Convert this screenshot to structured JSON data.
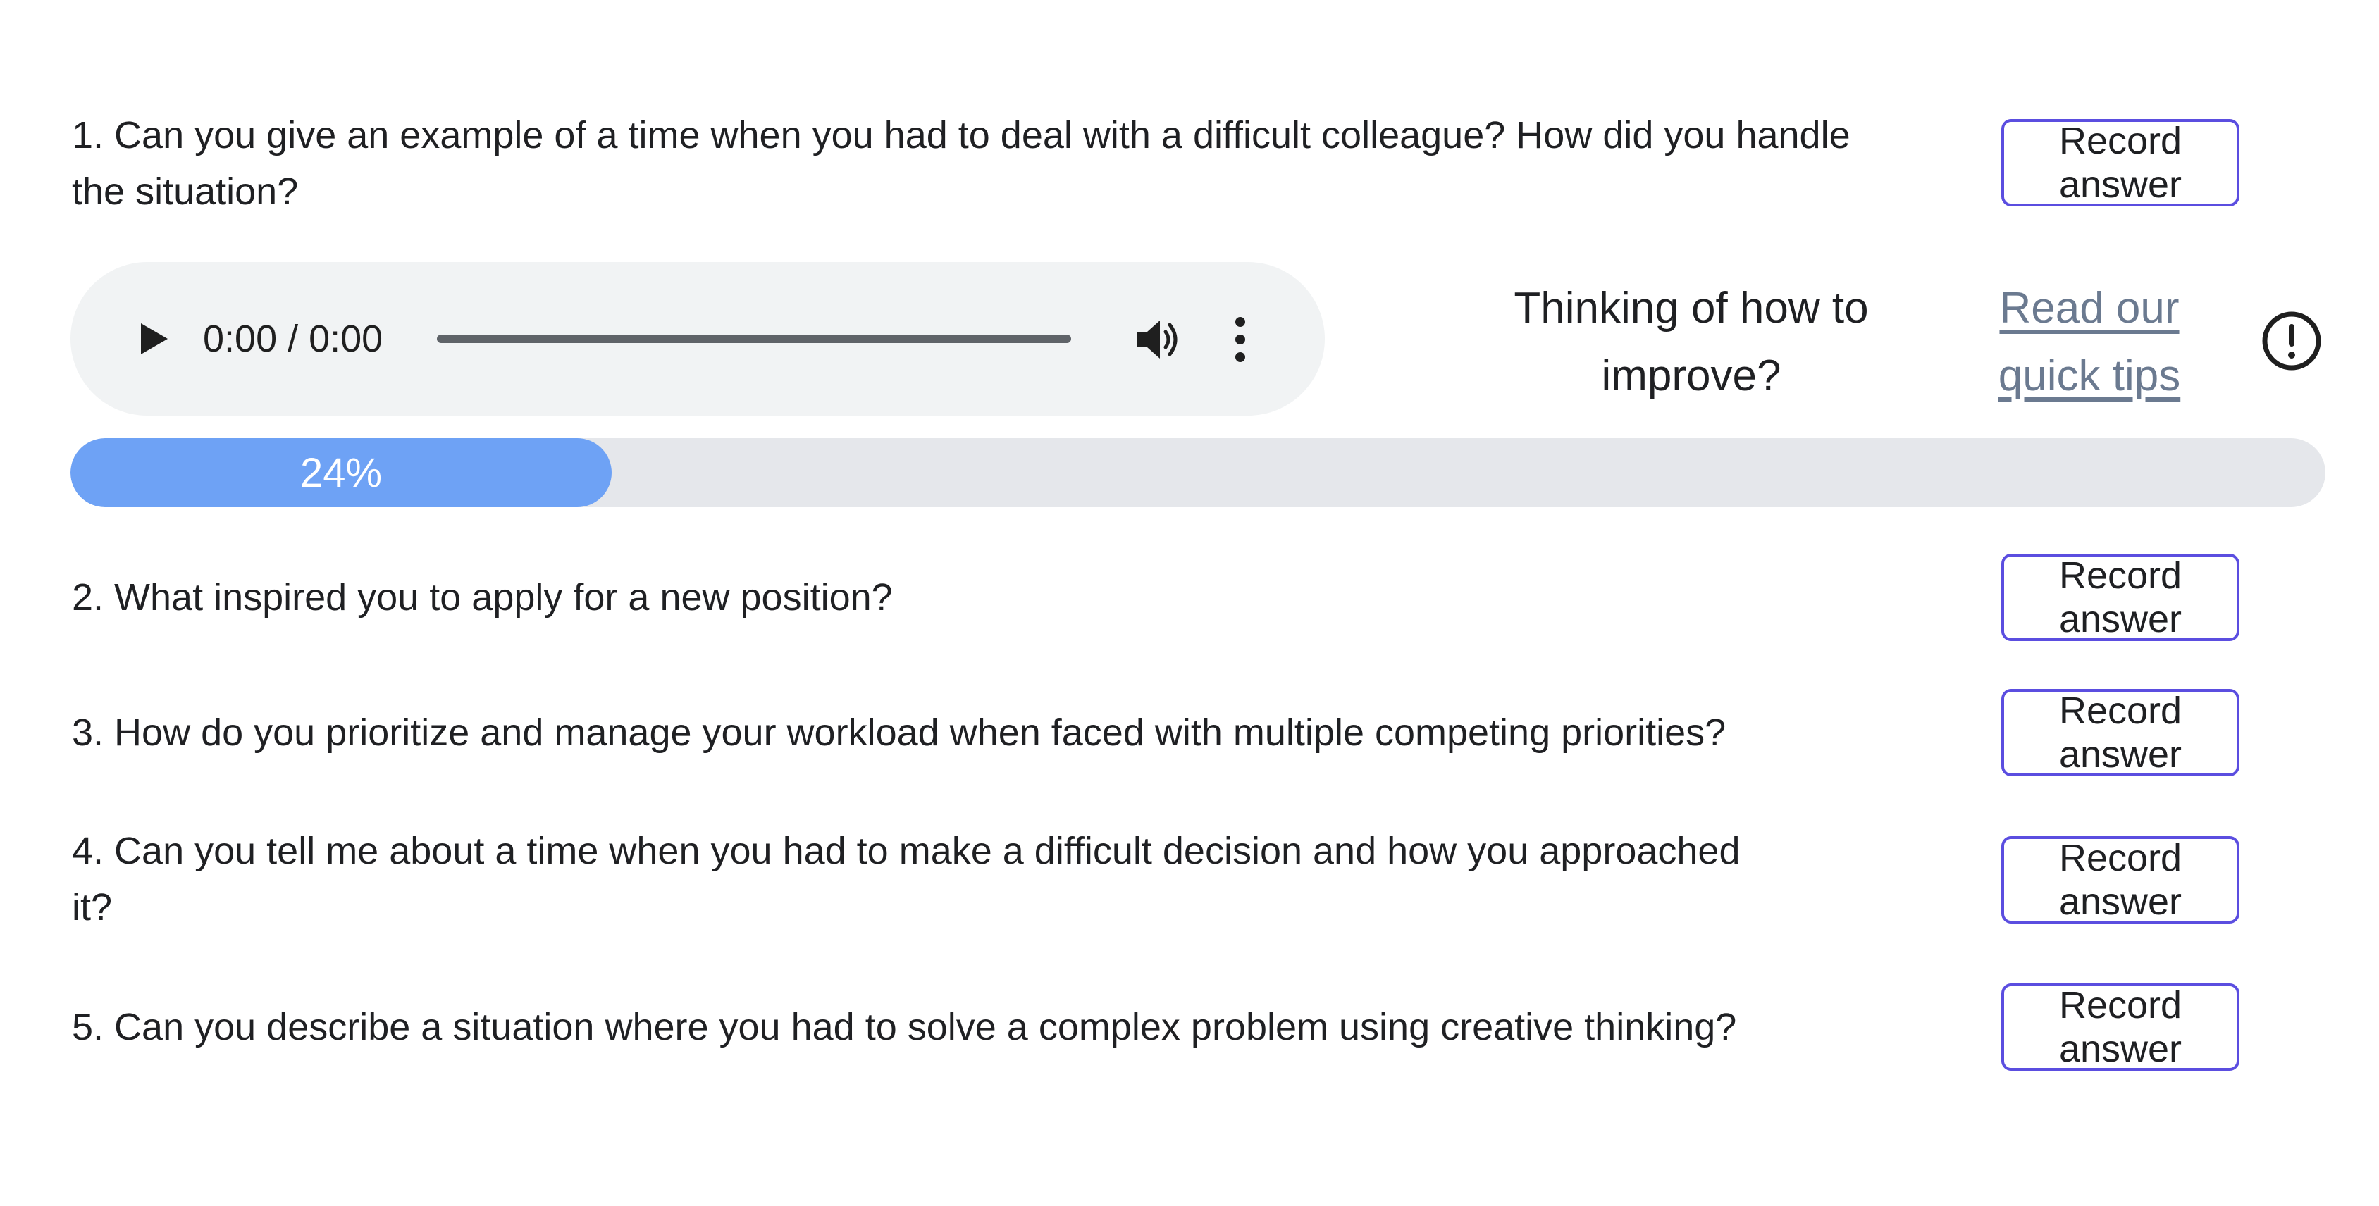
{
  "questions": [
    {
      "text": "1. Can you give an example of a time when you had to deal with a difficult colleague? How did you handle the situation?",
      "button": "Record answer"
    },
    {
      "text": "2. What inspired you to apply for a new position?",
      "button": "Record answer"
    },
    {
      "text": "3. How do you prioritize and manage your workload when faced with multiple competing priorities?",
      "button": "Record answer"
    },
    {
      "text": "4. Can you tell me about a time when you had to make a difficult decision and how you approached it?",
      "button": "Record answer"
    },
    {
      "text": "5. Can you describe a situation where you had to solve a complex problem using creative thinking?",
      "button": "Record answer"
    }
  ],
  "audio": {
    "time": "0:00 / 0:00",
    "icons": [
      "play-icon",
      "volume-icon",
      "more-vert-icon"
    ]
  },
  "improve": {
    "prompt": "Thinking of how to improve?",
    "link": "Read our quick tips",
    "icon": "alert-circle-icon"
  },
  "progress": {
    "value": 0.24,
    "label": "24%",
    "fill_color": "#6ea2f5",
    "track_color": "#e5e7eb"
  },
  "colors": {
    "button_border": "#5b4ee0",
    "link": "#6b7a90"
  }
}
